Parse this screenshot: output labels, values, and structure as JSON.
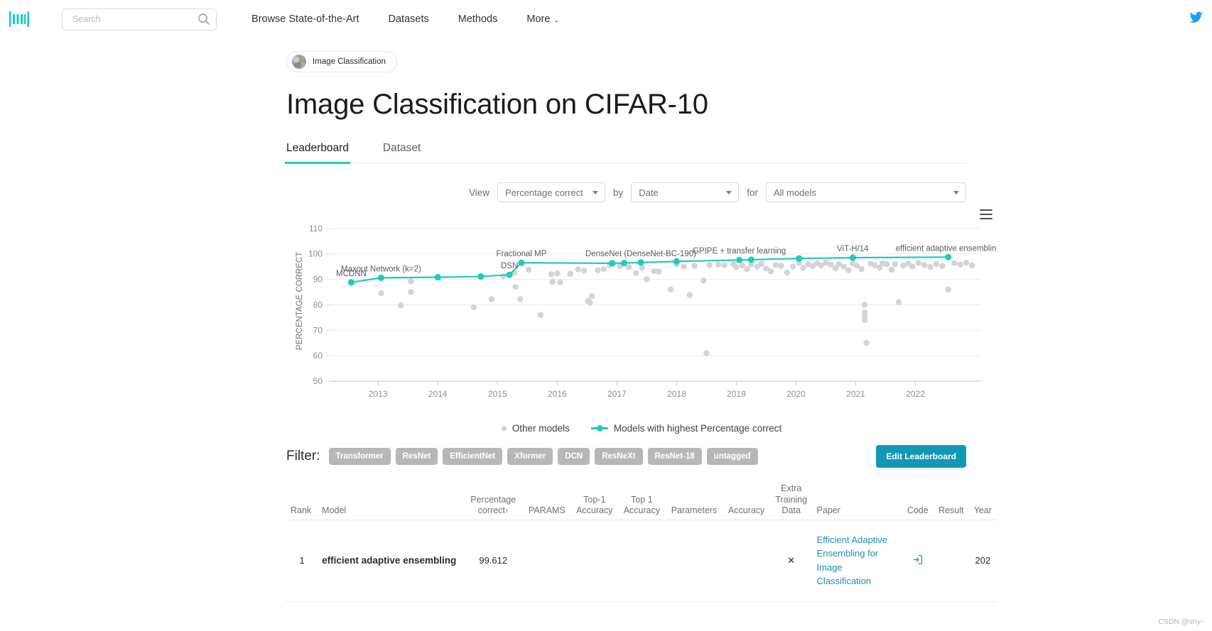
{
  "nav": {
    "logo_name": "papers-with-code-logo",
    "search": {
      "placeholder": "Search",
      "value": ""
    },
    "links": [
      {
        "label": "Browse State-of-the-Art",
        "has_caret": false
      },
      {
        "label": "Datasets",
        "has_caret": false
      },
      {
        "label": "Methods",
        "has_caret": false
      },
      {
        "label": "More",
        "has_caret": true
      }
    ],
    "caret": "⌄",
    "twitter_icon": "twitter-icon"
  },
  "task_chip": {
    "label": "Image Classification"
  },
  "page_title": "Image Classification on CIFAR-10",
  "tabs": [
    {
      "label": "Leaderboard",
      "active": true
    },
    {
      "label": "Dataset",
      "active": false
    }
  ],
  "controls": {
    "view_label": "View",
    "view_value": "Percentage correct",
    "by_label": "by",
    "by_value": "Date",
    "for_label": "for",
    "for_value": "All models"
  },
  "chart_data": {
    "type": "scatter",
    "title": "",
    "xlabel": "",
    "ylabel": "PERCENTAGE CORRECT",
    "xlim": [
      2012.2,
      2023.1
    ],
    "ylim": [
      50,
      113
    ],
    "yticks": [
      50,
      60,
      70,
      80,
      90,
      100,
      110
    ],
    "xticks": [
      2013,
      2014,
      2015,
      2016,
      2017,
      2018,
      2019,
      2020,
      2021,
      2022
    ],
    "grid": "horizontal",
    "legend": [
      {
        "name": "Other models",
        "marker": "dot",
        "color": "#cfd1d3"
      },
      {
        "name": "Models with highest Percentage correct",
        "marker": "line-dot",
        "color": "#21cbbb"
      }
    ],
    "series": [
      {
        "name": "Models with highest Percentage correct",
        "color": "#21cbbb",
        "points": [
          {
            "x": 2012.55,
            "y": 88.8,
            "label": "MCDNN"
          },
          {
            "x": 2013.05,
            "y": 90.6,
            "label": "Maxout Network (k=2)"
          },
          {
            "x": 2014.0,
            "y": 90.8,
            "label": ""
          },
          {
            "x": 2014.72,
            "y": 91.1,
            "label": ""
          },
          {
            "x": 2015.2,
            "y": 91.8,
            "label": "DSN"
          },
          {
            "x": 2015.4,
            "y": 96.5,
            "label": "Fractional MP"
          },
          {
            "x": 2016.92,
            "y": 96.3,
            "label": ""
          },
          {
            "x": 2017.12,
            "y": 96.4,
            "label": ""
          },
          {
            "x": 2017.4,
            "y": 96.6,
            "label": "DenseNet (DenseNet-BC-190)"
          },
          {
            "x": 2018.0,
            "y": 97.0,
            "label": ""
          },
          {
            "x": 2019.05,
            "y": 97.6,
            "label": "GPIPE + transfer learning"
          },
          {
            "x": 2019.25,
            "y": 97.7,
            "label": ""
          },
          {
            "x": 2020.05,
            "y": 98.2,
            "label": ""
          },
          {
            "x": 2020.95,
            "y": 98.5,
            "label": "ViT-H/14"
          },
          {
            "x": 2022.55,
            "y": 98.7,
            "label": "efficient adaptive ensembling"
          }
        ]
      },
      {
        "name": "Other models",
        "color": "#d2d4d6",
        "points": [
          {
            "x": 2013.05,
            "y": 84.5
          },
          {
            "x": 2013.38,
            "y": 79.8
          },
          {
            "x": 2013.55,
            "y": 89.2
          },
          {
            "x": 2013.55,
            "y": 85.0
          },
          {
            "x": 2014.6,
            "y": 79.0
          },
          {
            "x": 2014.9,
            "y": 82.2
          },
          {
            "x": 2015.1,
            "y": 91.2
          },
          {
            "x": 2015.28,
            "y": 92.6
          },
          {
            "x": 2015.3,
            "y": 87.0
          },
          {
            "x": 2015.38,
            "y": 82.2
          },
          {
            "x": 2015.52,
            "y": 93.8
          },
          {
            "x": 2015.72,
            "y": 76.0
          },
          {
            "x": 2015.9,
            "y": 92.0
          },
          {
            "x": 2015.92,
            "y": 89.0
          },
          {
            "x": 2016.0,
            "y": 92.3
          },
          {
            "x": 2016.05,
            "y": 88.8
          },
          {
            "x": 2016.22,
            "y": 92.1
          },
          {
            "x": 2016.35,
            "y": 93.9
          },
          {
            "x": 2016.45,
            "y": 93.4
          },
          {
            "x": 2016.52,
            "y": 81.4
          },
          {
            "x": 2016.55,
            "y": 80.8
          },
          {
            "x": 2016.58,
            "y": 83.4
          },
          {
            "x": 2016.68,
            "y": 93.6
          },
          {
            "x": 2016.78,
            "y": 94.0
          },
          {
            "x": 2016.88,
            "y": 95.5
          },
          {
            "x": 2017.05,
            "y": 95.2
          },
          {
            "x": 2017.2,
            "y": 94.8
          },
          {
            "x": 2017.32,
            "y": 92.5
          },
          {
            "x": 2017.42,
            "y": 94.5
          },
          {
            "x": 2017.5,
            "y": 90.0
          },
          {
            "x": 2017.62,
            "y": 93.2
          },
          {
            "x": 2017.7,
            "y": 93.0
          },
          {
            "x": 2017.9,
            "y": 86.0
          },
          {
            "x": 2018.0,
            "y": 95.9
          },
          {
            "x": 2018.12,
            "y": 95.0
          },
          {
            "x": 2018.22,
            "y": 83.8
          },
          {
            "x": 2018.3,
            "y": 95.3
          },
          {
            "x": 2018.45,
            "y": 89.5
          },
          {
            "x": 2018.5,
            "y": 61.0
          },
          {
            "x": 2018.55,
            "y": 95.6
          },
          {
            "x": 2018.7,
            "y": 95.8
          },
          {
            "x": 2018.8,
            "y": 95.5
          },
          {
            "x": 2018.95,
            "y": 96.0
          },
          {
            "x": 2019.0,
            "y": 94.8
          },
          {
            "x": 2019.1,
            "y": 95.4
          },
          {
            "x": 2019.18,
            "y": 94.0
          },
          {
            "x": 2019.25,
            "y": 95.9
          },
          {
            "x": 2019.35,
            "y": 95.0
          },
          {
            "x": 2019.42,
            "y": 96.1
          },
          {
            "x": 2019.5,
            "y": 94.2
          },
          {
            "x": 2019.58,
            "y": 93.1
          },
          {
            "x": 2019.66,
            "y": 95.6
          },
          {
            "x": 2019.75,
            "y": 95.3
          },
          {
            "x": 2019.85,
            "y": 92.6
          },
          {
            "x": 2019.95,
            "y": 95.0
          },
          {
            "x": 2020.05,
            "y": 96.4
          },
          {
            "x": 2020.12,
            "y": 94.5
          },
          {
            "x": 2020.2,
            "y": 96.0
          },
          {
            "x": 2020.28,
            "y": 95.2
          },
          {
            "x": 2020.35,
            "y": 96.2
          },
          {
            "x": 2020.42,
            "y": 95.4
          },
          {
            "x": 2020.5,
            "y": 96.5
          },
          {
            "x": 2020.58,
            "y": 95.8
          },
          {
            "x": 2020.66,
            "y": 94.3
          },
          {
            "x": 2020.72,
            "y": 96.0
          },
          {
            "x": 2020.8,
            "y": 95.0
          },
          {
            "x": 2020.88,
            "y": 93.6
          },
          {
            "x": 2020.95,
            "y": 96.2
          },
          {
            "x": 2021.02,
            "y": 95.3
          },
          {
            "x": 2021.1,
            "y": 94.0
          },
          {
            "x": 2021.15,
            "y": 80.0
          },
          {
            "x": 2021.15,
            "y": 77.0
          },
          {
            "x": 2021.15,
            "y": 75.5
          },
          {
            "x": 2021.15,
            "y": 74.0
          },
          {
            "x": 2021.18,
            "y": 65.0
          },
          {
            "x": 2021.25,
            "y": 96.1
          },
          {
            "x": 2021.32,
            "y": 95.5
          },
          {
            "x": 2021.4,
            "y": 94.6
          },
          {
            "x": 2021.45,
            "y": 96.3
          },
          {
            "x": 2021.52,
            "y": 95.9
          },
          {
            "x": 2021.6,
            "y": 93.8
          },
          {
            "x": 2021.66,
            "y": 96.0
          },
          {
            "x": 2021.72,
            "y": 81.0
          },
          {
            "x": 2021.8,
            "y": 95.4
          },
          {
            "x": 2021.88,
            "y": 96.2
          },
          {
            "x": 2021.95,
            "y": 95.0
          },
          {
            "x": 2022.05,
            "y": 96.4
          },
          {
            "x": 2022.15,
            "y": 95.6
          },
          {
            "x": 2022.25,
            "y": 94.8
          },
          {
            "x": 2022.35,
            "y": 96.0
          },
          {
            "x": 2022.45,
            "y": 95.2
          },
          {
            "x": 2022.55,
            "y": 86.0
          },
          {
            "x": 2022.65,
            "y": 96.3
          },
          {
            "x": 2022.75,
            "y": 95.8
          },
          {
            "x": 2022.85,
            "y": 96.5
          },
          {
            "x": 2022.95,
            "y": 95.5
          }
        ]
      }
    ]
  },
  "filter": {
    "label": "Filter:",
    "tags": [
      "Transformer",
      "ResNet",
      "EfficientNet",
      "Xformer",
      "DCN",
      "ResNeXt",
      "ResNet-18",
      "untagged"
    ],
    "edit_button": "Edit Leaderboard"
  },
  "table": {
    "headers": [
      "Rank",
      "Model",
      "Percentage correct",
      "PARAMS",
      "Top-1 Accuracy",
      "Top 1 Accuracy",
      "Parameters",
      "Accuracy",
      "Extra Training Data",
      "Paper",
      "Code",
      "Result",
      "Year"
    ],
    "sort_indicator": "↑",
    "rows": [
      {
        "rank": "1",
        "model": "efficient adaptive ensembling",
        "percentage_correct": "99.612",
        "params": "",
        "top1_accuracy": "",
        "top_1_accuracy": "",
        "parameters": "",
        "accuracy": "",
        "extra_training_data": "✕",
        "paper": "Efficient Adaptive Ensembling for Image Classification",
        "code": "code-link-icon",
        "result": "",
        "year": "202"
      }
    ]
  },
  "watermark": "CSDN @shy~",
  "colors": {
    "accent": "#21cbbb",
    "link": "#1f8fae",
    "button": "#1298b4",
    "tag": "#b7b7b7"
  }
}
